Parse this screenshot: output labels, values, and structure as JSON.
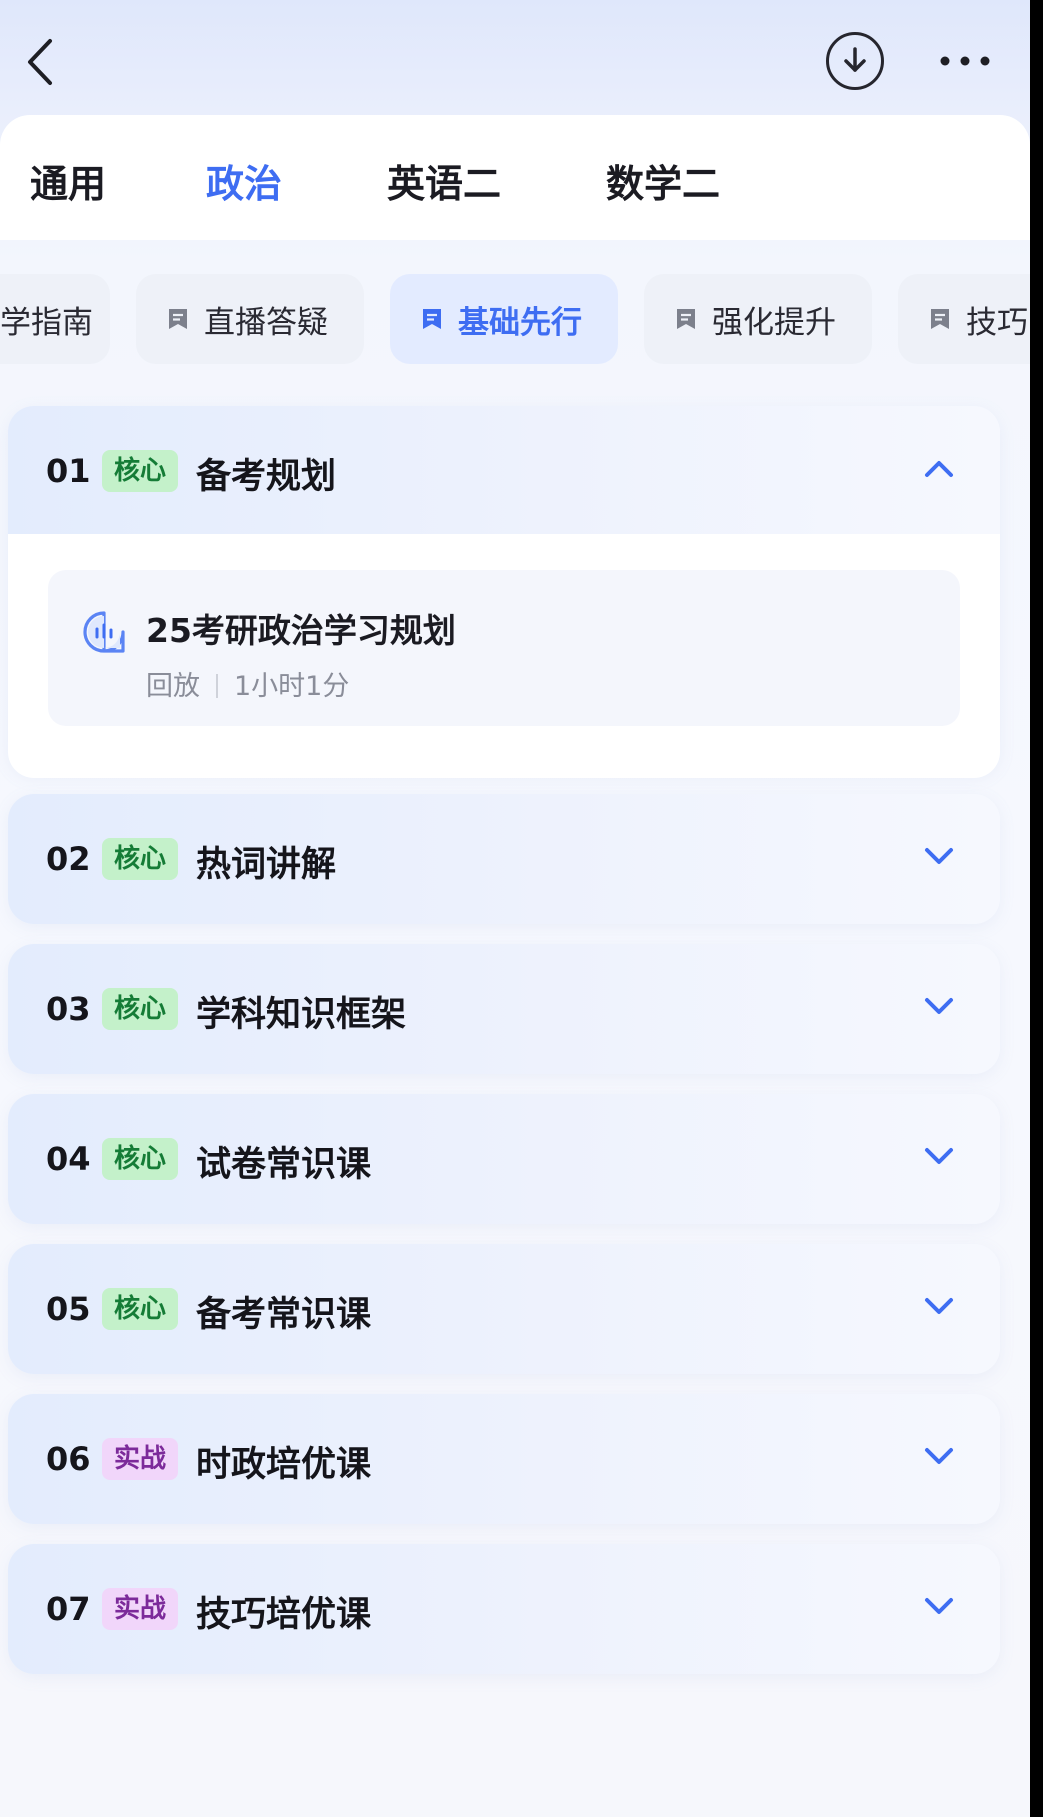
{
  "subject_tabs": [
    {
      "label": "通用"
    },
    {
      "label": "政治"
    },
    {
      "label": "英语二"
    },
    {
      "label": "数学二"
    }
  ],
  "categories": [
    {
      "label": "学指南"
    },
    {
      "label": "直播答疑"
    },
    {
      "label": "基础先行"
    },
    {
      "label": "强化提升"
    },
    {
      "label": "技巧"
    }
  ],
  "sections": [
    {
      "num": "01",
      "tag": "核心",
      "title": "备考规划"
    },
    {
      "num": "02",
      "tag": "核心",
      "title": "热词讲解"
    },
    {
      "num": "03",
      "tag": "核心",
      "title": "学科知识框架"
    },
    {
      "num": "04",
      "tag": "核心",
      "title": "试卷常识课"
    },
    {
      "num": "05",
      "tag": "核心",
      "title": "备考常识课"
    },
    {
      "num": "06",
      "tag": "实战",
      "title": "时政培优课"
    },
    {
      "num": "07",
      "tag": "实战",
      "title": "技巧培优课"
    }
  ],
  "open_lesson": {
    "title": "25考研政治学习规划",
    "type": "回放",
    "duration": "1小时1分"
  },
  "colors": {
    "accent": "#3e6df2",
    "core_tag_bg": "#c4f1ca",
    "practice_tag_bg": "#f1d6fa"
  },
  "icons": [
    "back-arrow-icon",
    "download-icon",
    "more-icon",
    "bookmark-icon",
    "chevron-up-icon",
    "chevron-down-icon",
    "live-replay-icon"
  ]
}
